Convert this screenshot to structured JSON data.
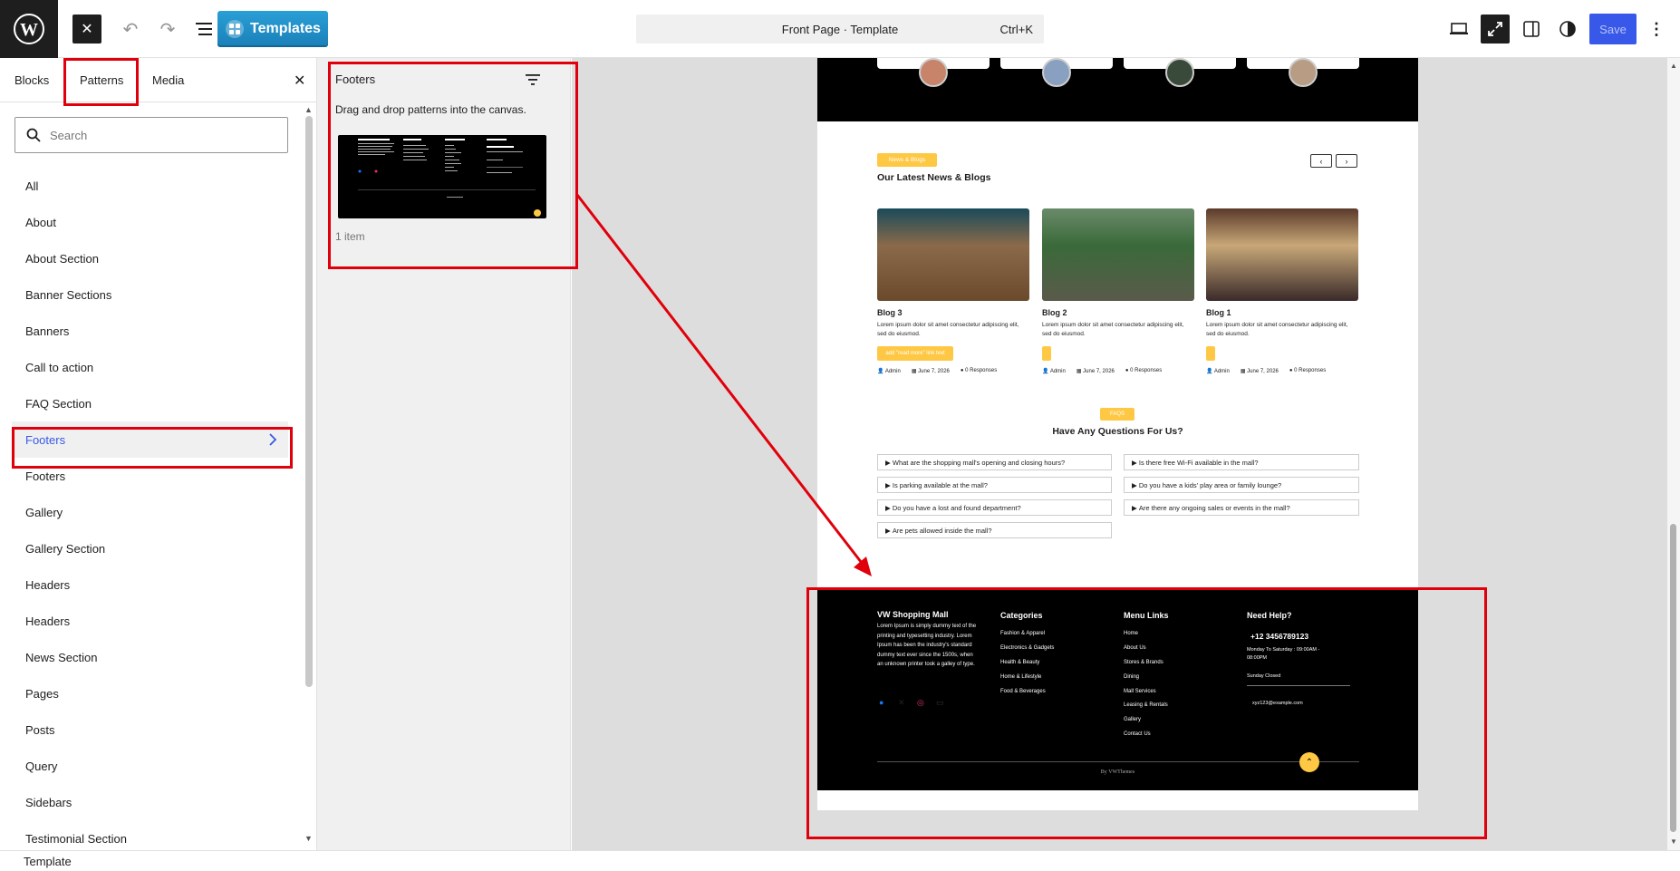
{
  "topbar": {
    "templates_label": "Templates",
    "command_title": "Front Page · Template",
    "command_shortcut": "Ctrl+K",
    "save_label": "Save"
  },
  "inserter": {
    "tabs": [
      "Blocks",
      "Patterns",
      "Media"
    ],
    "search_placeholder": "Search",
    "categories": [
      "All",
      "About",
      "About Section",
      "Banner Sections",
      "Banners",
      "Call to action",
      "FAQ Section",
      "Footers",
      "Footers",
      "Gallery",
      "Gallery Section",
      "Headers",
      "Headers",
      "News Section",
      "Pages",
      "Posts",
      "Query",
      "Sidebars",
      "Testimonial Section"
    ],
    "active_category_index": 7
  },
  "patterns_panel": {
    "title": "Footers",
    "hint": "Drag and drop patterns into the canvas.",
    "count": "1 item"
  },
  "page": {
    "news_badge": "News & Blogs",
    "news_heading": "Our Latest News & Blogs",
    "blogs": [
      {
        "title": "Blog 3",
        "excerpt": "Lorem ipsum dolor sit amet consectetur adipiscing elit, sed do eiusmod.",
        "button": "add \"read more\" link text",
        "author": "Admin",
        "date": "June 7, 2026",
        "responses": "0 Responses"
      },
      {
        "title": "Blog 2",
        "excerpt": "Lorem ipsum dolor sit amet consectetur adipiscing elit, sed do eiusmod.",
        "button": "",
        "author": "Admin",
        "date": "June 7, 2026",
        "responses": "0 Responses"
      },
      {
        "title": "Blog 1",
        "excerpt": "Lorem ipsum dolor sit amet consectetur adipiscing elit, sed do eiusmod.",
        "button": "",
        "author": "Admin",
        "date": "June 7, 2026",
        "responses": "0 Responses"
      }
    ],
    "faq_badge": "FAQS",
    "faq_heading": "Have Any Questions For Us?",
    "faqs_left": [
      "What are the shopping mall's opening and closing hours?",
      "Is parking available at the mall?",
      "Do you have a lost and found department?",
      "Are pets allowed inside the mall?"
    ],
    "faqs_right": [
      "Is there free Wi-Fi available in the mall?",
      "Do you have a kids' play area or family lounge?",
      "Are there any ongoing sales or events in the mall?"
    ],
    "footer": {
      "brand": "VW Shopping Mall",
      "about": "Lorem Ipsum is simply dummy text of the printing and typesetting industry. Lorem Ipsum has been the industry's standard dummy text ever since the 1500s, when an unknown printer took a galley of type.",
      "categories_title": "Categories",
      "categories": [
        "Fashion & Apparel",
        "Electronics & Gadgets",
        "Health & Beauty",
        "Home & Lifestyle",
        "Food & Beverages"
      ],
      "menu_title": "Menu Links",
      "menu": [
        "Home",
        "About Us",
        "Stores & Brands",
        "Dining",
        "Mall Services",
        "Leasing & Rentals",
        "Gallery",
        "Contact Us"
      ],
      "help_title": "Need Help?",
      "phone": "+12 3456789123",
      "hours": "Monday To Saturday : 09:00AM - 08:00PM",
      "closed": "Sunday Closed",
      "email": "xyz123@example.com",
      "credit": "By VWThemes"
    }
  },
  "statusbar": {
    "label": "Template"
  }
}
